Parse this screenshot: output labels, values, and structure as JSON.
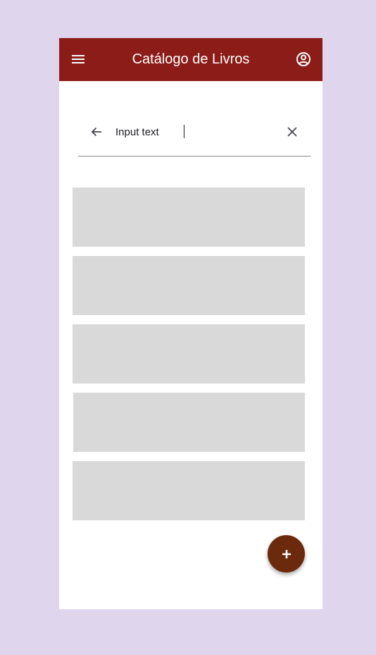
{
  "app_bar": {
    "title": "Catálogo de Livros",
    "menu_icon": "menu-icon",
    "account_icon": "account-circle-icon",
    "background": "#8c1c18"
  },
  "search": {
    "value": "Input text",
    "back_icon": "arrow-back-icon",
    "clear_icon": "close-icon"
  },
  "book_list": {
    "items": [
      "",
      "",
      "",
      "",
      ""
    ],
    "placeholder_color": "#d9d9d9"
  },
  "fab": {
    "label": "+",
    "icon": "add-icon",
    "color": "#6b2a0c"
  },
  "page_background": "#dfd5ec"
}
